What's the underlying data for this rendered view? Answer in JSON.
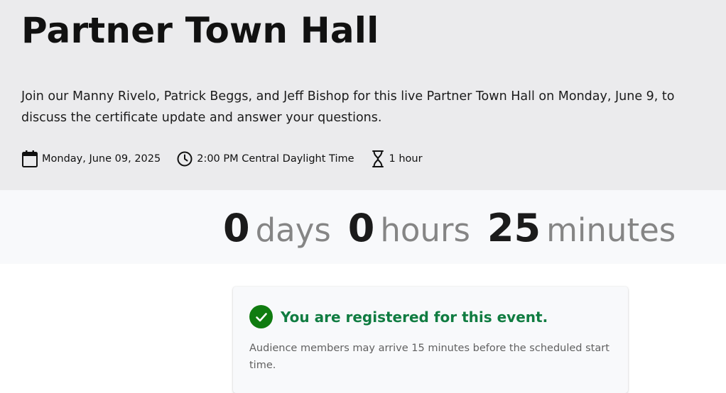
{
  "event": {
    "title": "Partner Town Hall",
    "description": "Join our Manny Rivelo, Patrick Beggs, and Jeff Bishop for this live Partner Town Hall on Monday, June 9, to discuss the certificate update and answer your questions.",
    "meta": {
      "date": "Monday, June 09, 2025",
      "date_icon": "calendar-icon",
      "time": "2:00 PM Central Daylight Time",
      "time_icon": "clock-icon",
      "duration": "1 hour",
      "duration_icon": "hourglass-icon"
    }
  },
  "countdown": {
    "days_value": "0",
    "days_label": "days",
    "hours_value": "0",
    "hours_label": "hours",
    "minutes_value": "25",
    "minutes_label": "minutes"
  },
  "registration": {
    "icon": "check-circle-icon",
    "status": "You are registered for this event.",
    "note": "Audience members may arrive 15 minutes before the scheduled start time.",
    "accent_color": "#107c41"
  }
}
